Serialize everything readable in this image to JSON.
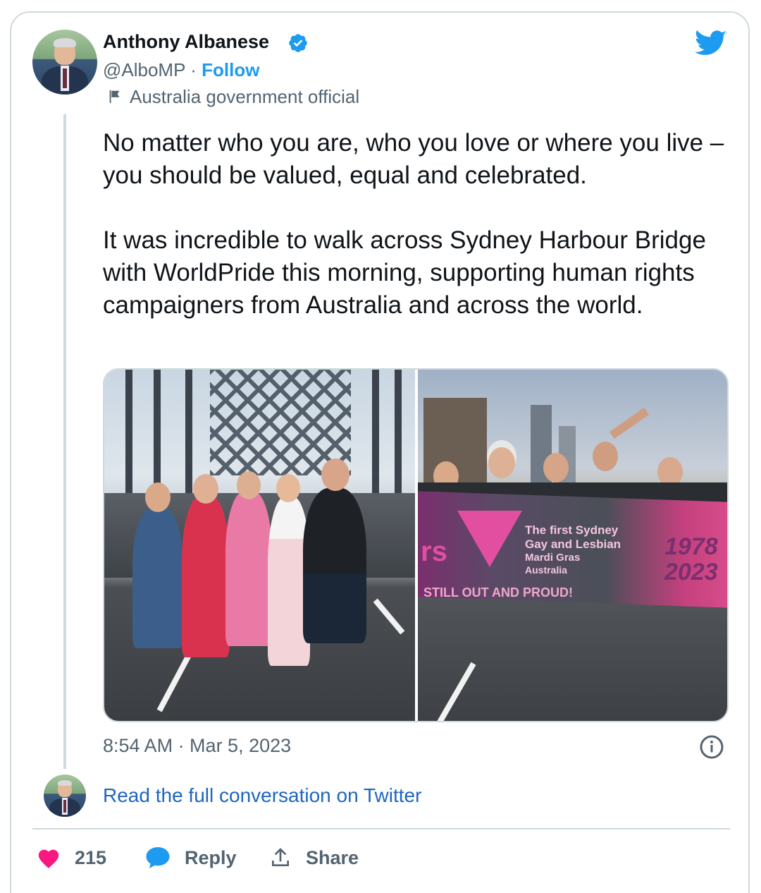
{
  "author": {
    "name": "Anthony Albanese",
    "handle": "@AlboMP",
    "separator": "·",
    "follow_label": "Follow",
    "label": "Australia government official"
  },
  "tweet": {
    "paragraph1": "No matter who you are, who you love or where you live – you should be valued, equal and celebrated.",
    "paragraph2": "It was incredible to walk across Sydney Harbour Bridge with WorldPride this morning, supporting human rights campaigners from Australia and across the world.",
    "timestamp": "8:54 AM · Mar 5, 2023"
  },
  "media": {
    "banner_line1": "The first Sydney",
    "banner_line2": "Gay and Lesbian",
    "banner_line3": "Mardi Gras",
    "banner_line4": "Australia",
    "banner_slogan": "STILL OUT AND PROUD!",
    "banner_year1": "1978",
    "banner_year2": "2023",
    "banner_fragment": "rs"
  },
  "conversation": {
    "read_full_label": "Read the full conversation on Twitter"
  },
  "actions": {
    "like_count": "215",
    "reply_label": "Reply",
    "share_label": "Share"
  },
  "colors": {
    "accent": "#1d9bf0",
    "like": "#f91880",
    "muted": "#536471"
  }
}
